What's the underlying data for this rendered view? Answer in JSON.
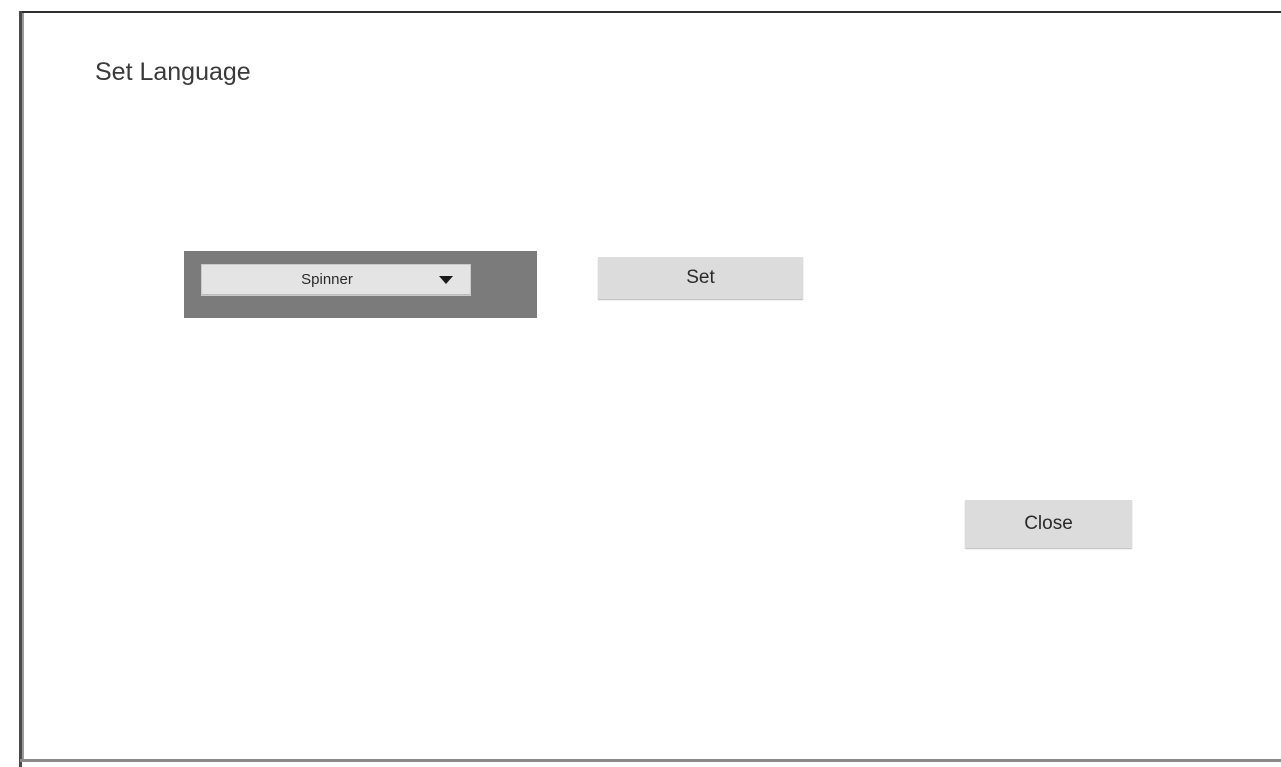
{
  "dialog": {
    "title": "Set Language"
  },
  "spinner": {
    "selected_value": "Spinner",
    "arrow_icon": "dropdown-arrow-icon"
  },
  "buttons": {
    "set_label": "Set",
    "close_label": "Close"
  }
}
